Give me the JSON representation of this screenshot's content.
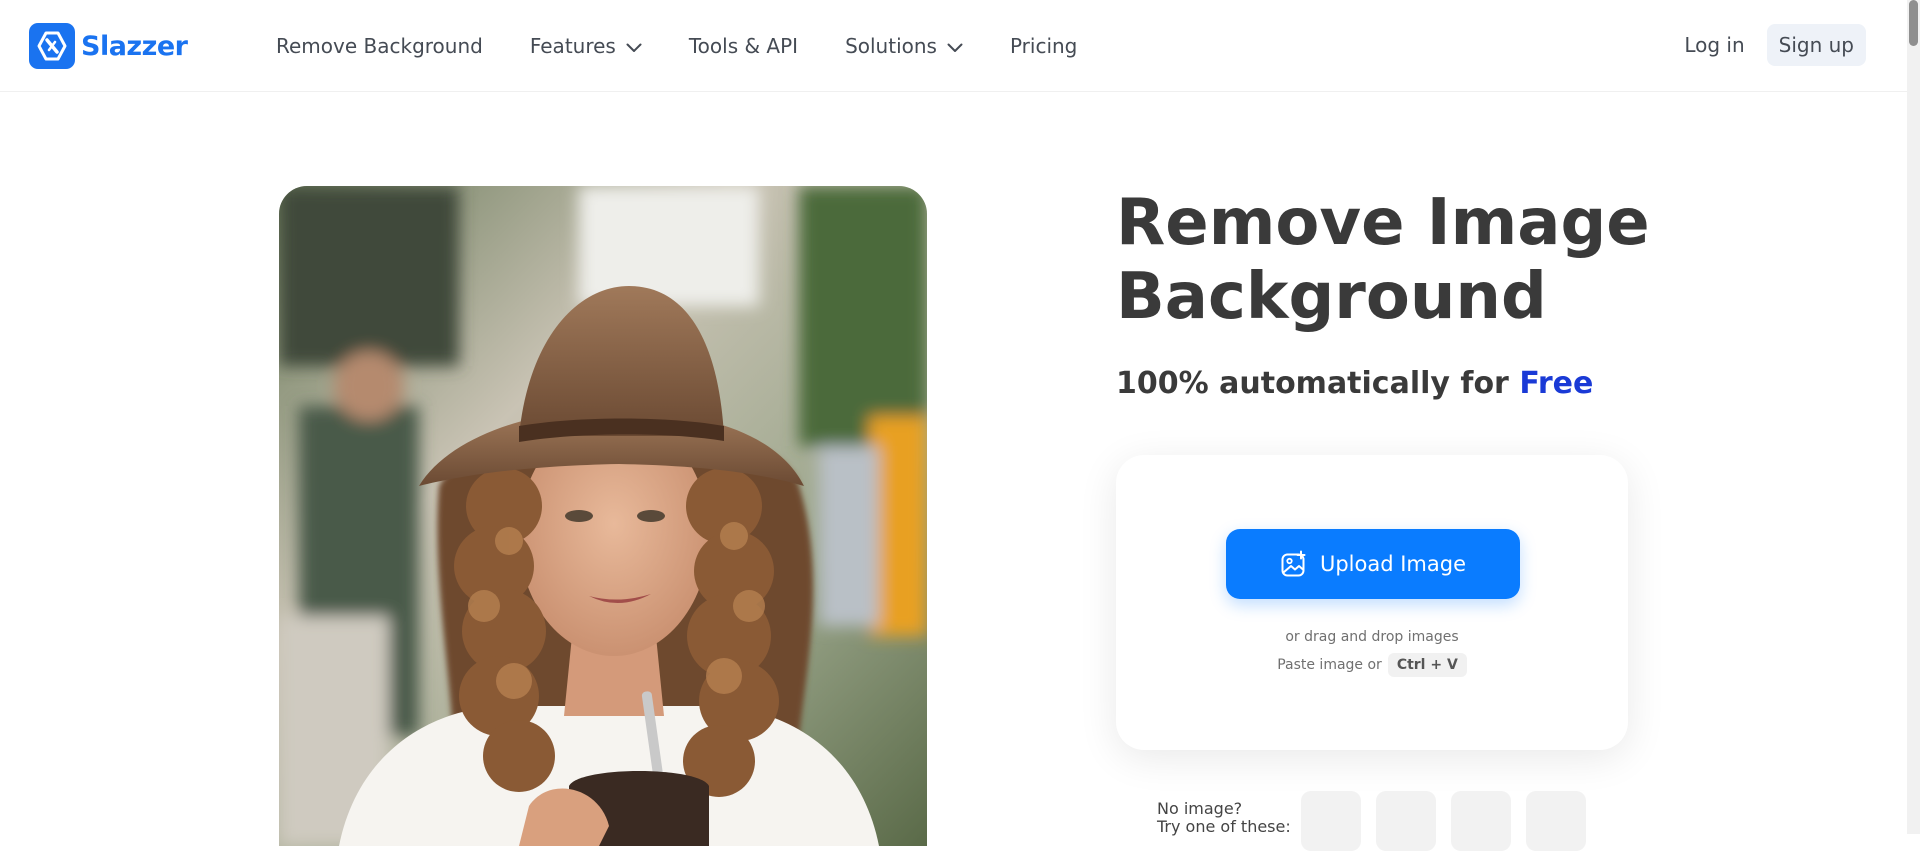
{
  "header": {
    "logo_text": "Slazzer",
    "nav": [
      {
        "label": "Remove Background",
        "has_dropdown": false
      },
      {
        "label": "Features",
        "has_dropdown": true
      },
      {
        "label": "Tools & API",
        "has_dropdown": false
      },
      {
        "label": "Solutions",
        "has_dropdown": true
      },
      {
        "label": "Pricing",
        "has_dropdown": false
      }
    ],
    "login_label": "Log in",
    "signup_label": "Sign up"
  },
  "hero": {
    "title_line1": "Remove Image",
    "title_line2": "Background",
    "subtitle_prefix": "100% automatically for",
    "subtitle_highlight": "Free"
  },
  "upload": {
    "button_label": "Upload Image",
    "drag_text": "or drag and drop images",
    "paste_text": "Paste image or",
    "shortcut": "Ctrl + V"
  },
  "samples": {
    "prompt_line1": "No image?",
    "prompt_line2": "Try one of these:",
    "count": 4
  },
  "colors": {
    "brand": "#1a73f0",
    "upload_button": "#0a7cff",
    "free_highlight": "#1a3ad6"
  },
  "icons": {
    "logo": "slazzer-logo-icon",
    "dropdown": "chevron-down-icon",
    "upload": "image-upload-icon"
  }
}
